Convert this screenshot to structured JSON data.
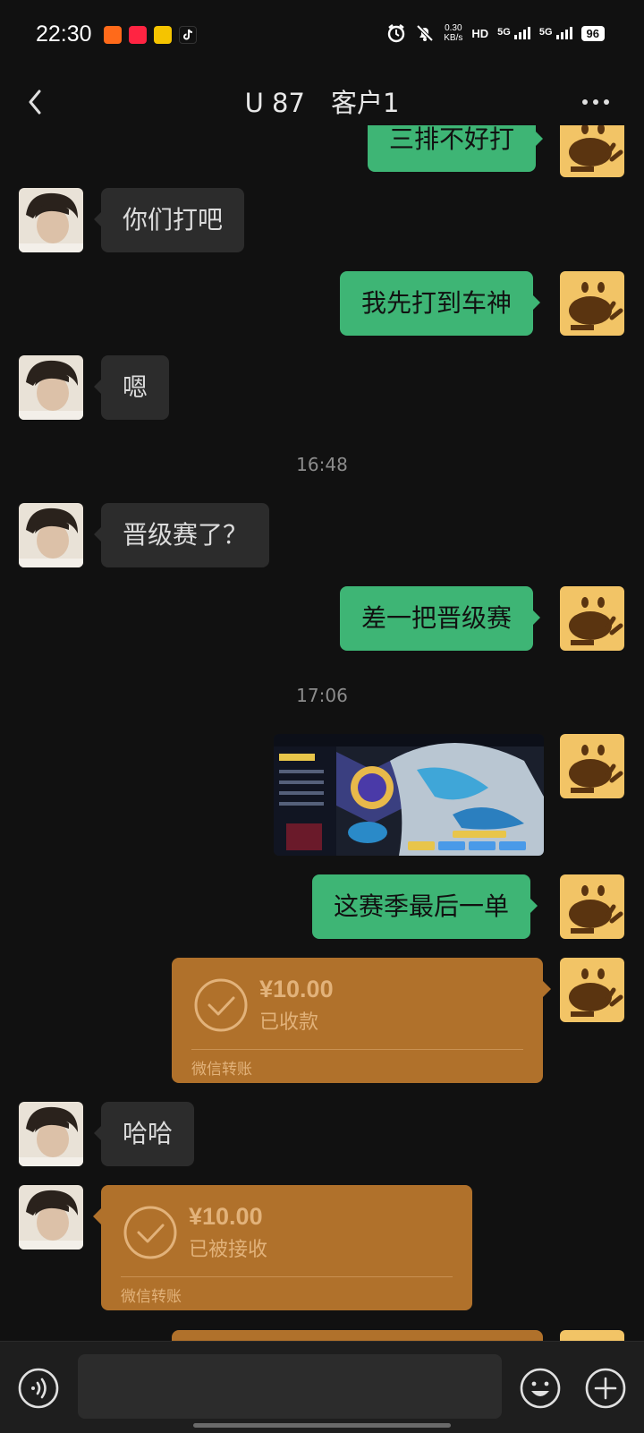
{
  "status_bar": {
    "time": "22:30",
    "net_speed_value": "0.30",
    "net_speed_unit": "KB/s",
    "hd_label": "HD",
    "signal_1_label": "5G",
    "signal_2_label": "5G",
    "battery": "96",
    "app_icon_names": [
      "kuaishou-icon",
      "xiaohongshu-icon",
      "taxi-icon",
      "tiktok-icon"
    ]
  },
  "header": {
    "title": "U 87　客户1"
  },
  "messages": [
    {
      "side": "out",
      "text": "三排不好打"
    },
    {
      "side": "in",
      "text": "你们打吧"
    },
    {
      "side": "out",
      "text": "我先打到车神"
    },
    {
      "side": "in",
      "text": "嗯"
    },
    {
      "type": "time",
      "text": "16:48"
    },
    {
      "side": "in",
      "text": "晋级赛了？"
    },
    {
      "side": "out",
      "text": "差一把晋级赛"
    },
    {
      "type": "time",
      "text": "17:06"
    },
    {
      "side": "out",
      "type": "image",
      "alt": "game-screenshot"
    },
    {
      "side": "out",
      "text": "这赛季最后一单"
    },
    {
      "side": "out",
      "type": "transfer",
      "amount": "¥10.00",
      "status": "已收款",
      "source": "微信转账"
    },
    {
      "side": "in",
      "text": "哈哈"
    },
    {
      "side": "in",
      "type": "transfer",
      "amount": "¥10.00",
      "status": "已被接收",
      "source": "微信转账"
    }
  ],
  "colors": {
    "background": "#111111",
    "outgoing_bubble": "#3eb575",
    "incoming_bubble": "#2c2c2c",
    "transfer_card": "#b0712b"
  },
  "input_bar": {
    "placeholder": ""
  }
}
